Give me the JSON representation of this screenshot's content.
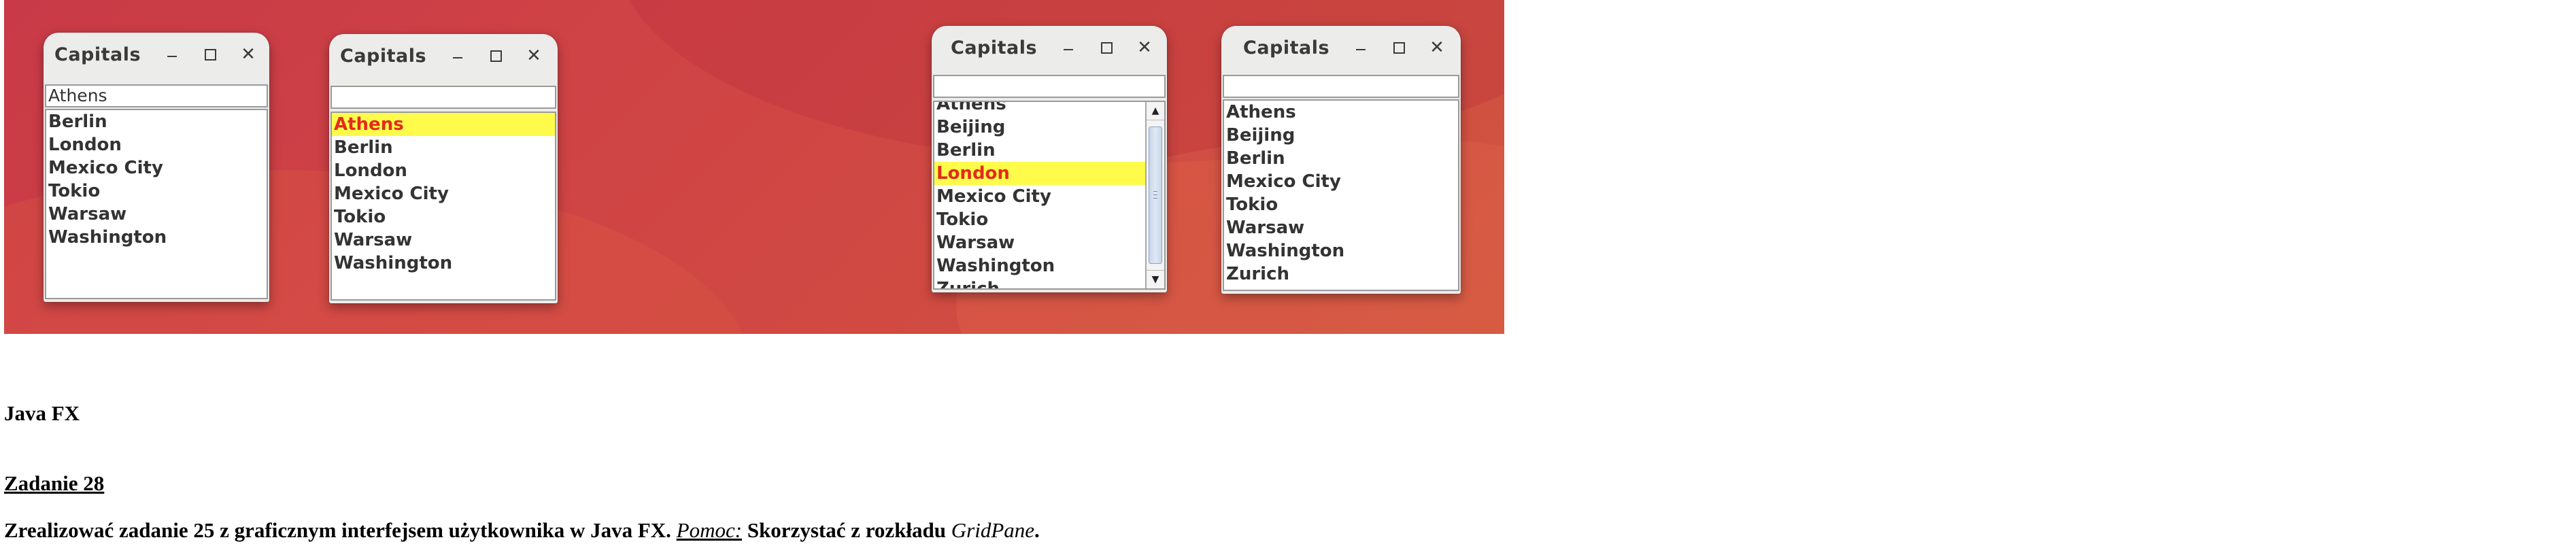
{
  "windows": [
    {
      "title": "Capitals",
      "field_value": "Athens",
      "items": [
        {
          "label": "Berlin",
          "selected": false
        },
        {
          "label": "London",
          "selected": false
        },
        {
          "label": "Mexico City",
          "selected": false
        },
        {
          "label": "Tokio",
          "selected": false
        },
        {
          "label": "Warsaw",
          "selected": false
        },
        {
          "label": "Washington",
          "selected": false
        }
      ],
      "scrollbar": false
    },
    {
      "title": "Capitals",
      "field_value": "",
      "items": [
        {
          "label": "Athens",
          "selected": true
        },
        {
          "label": "Berlin",
          "selected": false
        },
        {
          "label": "London",
          "selected": false
        },
        {
          "label": "Mexico City",
          "selected": false
        },
        {
          "label": "Tokio",
          "selected": false
        },
        {
          "label": "Warsaw",
          "selected": false
        },
        {
          "label": "Washington",
          "selected": false
        }
      ],
      "scrollbar": false
    },
    {
      "title": "Capitals",
      "field_value": "",
      "items": [
        {
          "label": "Athens",
          "selected": false
        },
        {
          "label": "Beijing",
          "selected": false
        },
        {
          "label": "Berlin",
          "selected": false
        },
        {
          "label": "London",
          "selected": true
        },
        {
          "label": "Mexico City",
          "selected": false
        },
        {
          "label": "Tokio",
          "selected": false
        },
        {
          "label": "Warsaw",
          "selected": false
        },
        {
          "label": "Washington",
          "selected": false
        },
        {
          "label": "Zurich",
          "selected": false
        }
      ],
      "scrollbar": true
    },
    {
      "title": "Capitals",
      "field_value": "",
      "items": [
        {
          "label": "Athens",
          "selected": false
        },
        {
          "label": "Beijing",
          "selected": false
        },
        {
          "label": "Berlin",
          "selected": false
        },
        {
          "label": "Mexico City",
          "selected": false
        },
        {
          "label": "Tokio",
          "selected": false
        },
        {
          "label": "Warsaw",
          "selected": false
        },
        {
          "label": "Washington",
          "selected": false
        },
        {
          "label": "Zurich",
          "selected": false
        }
      ],
      "scrollbar": false
    }
  ],
  "window_controls": {
    "minimize_icon": "minimize-icon",
    "maximize_icon": "maximize-icon",
    "close_icon": "close-icon",
    "close_glyph": "✕"
  },
  "document": {
    "heading": "Java FX",
    "task_title": "Zadanie 28",
    "paragraph_part1": "Zrealizować zadanie 25 z graficznym interfejsem użytkownika w Java FX. ",
    "paragraph_hint": "Pomoc:",
    "paragraph_part2": " Skorzystać z rozkładu ",
    "paragraph_layout": "GridPane",
    "paragraph_end": "."
  },
  "colors": {
    "selection_bg": "#fffb4a",
    "selection_text": "#e32b1d",
    "banner": "#cf4245"
  }
}
